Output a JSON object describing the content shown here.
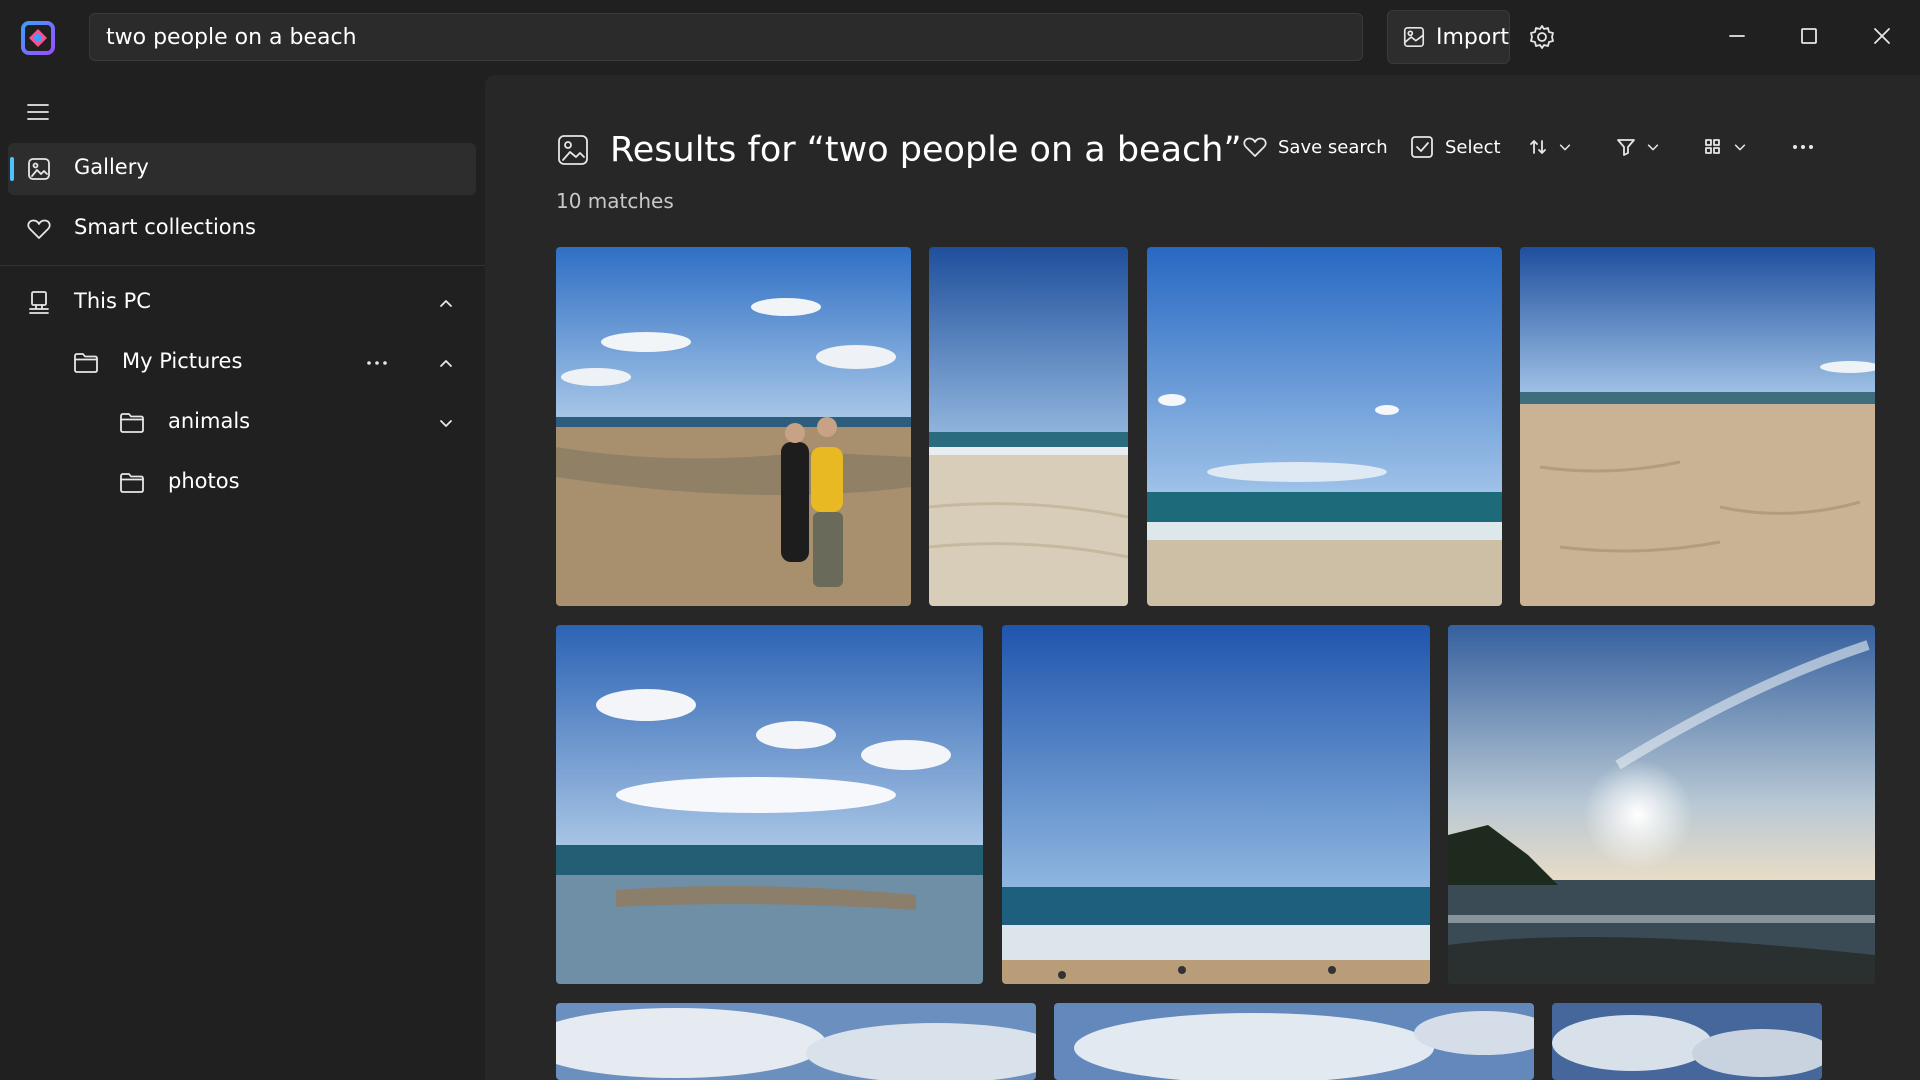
{
  "search": {
    "value": "two people on a beach"
  },
  "header": {
    "import_label": "Import"
  },
  "sidebar": {
    "gallery_label": "Gallery",
    "smart_collections_label": "Smart collections",
    "this_pc_label": "This PC",
    "my_pictures_label": "My Pictures",
    "animals_label": "animals",
    "photos_label": "photos"
  },
  "main": {
    "title": "Results for “two people on a beach”",
    "match_count": "10 matches",
    "toolbar": {
      "save_search_label": "Save search",
      "select_label": "Select"
    }
  },
  "photos": [
    "beach-two-people",
    "beach-sand-shore",
    "ocean-blue-sky",
    "sandy-beach",
    "ocean-clouds",
    "ocean-swimmers",
    "sunset-coast",
    "clouds-1",
    "clouds-2",
    "clouds-3"
  ],
  "colors": {
    "accent": "#4cc2ff",
    "background": "#202020",
    "panel": "#272727"
  }
}
